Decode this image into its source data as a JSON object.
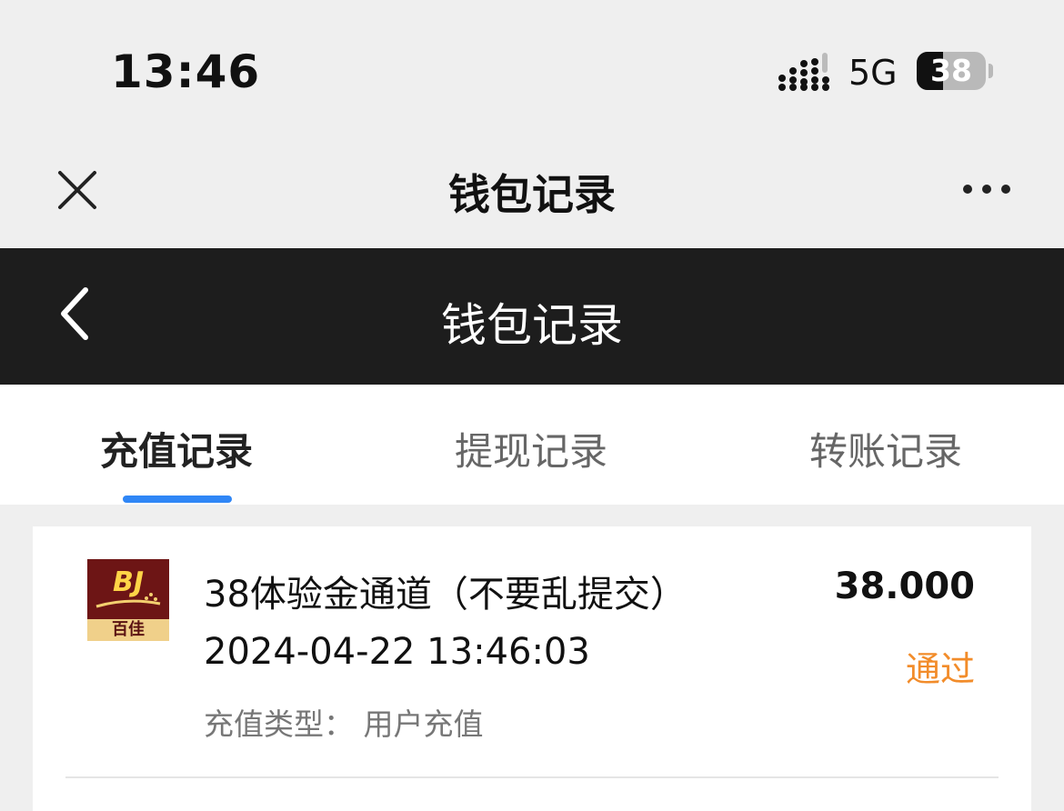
{
  "status_bar": {
    "time": "13:46",
    "network": "5G",
    "battery_level": "38"
  },
  "top_nav": {
    "title": "钱包记录",
    "close_icon": "close-icon",
    "more_icon": "more-horizontal-icon"
  },
  "app_header": {
    "title": "钱包记录",
    "back_icon": "chevron-left-icon"
  },
  "tabs": [
    {
      "label": "充值记录",
      "active": true
    },
    {
      "label": "提现记录",
      "active": false
    },
    {
      "label": "转账记录",
      "active": false
    }
  ],
  "records": [
    {
      "logo": {
        "mark": "BJ",
        "text": "百佳"
      },
      "title": "38体验金通道（不要乱提交）",
      "time": "2024-04-22 13:46:03",
      "type": "充值类型：  用户充值",
      "amount": "38.000",
      "status": "通过"
    }
  ],
  "colors": {
    "dark_header": "#1d1d1d",
    "tab_indicator": "#2f86f6",
    "status_success": "#f28c2a",
    "logo_background": "#6d1515",
    "logo_accent": "#f0d08a"
  }
}
